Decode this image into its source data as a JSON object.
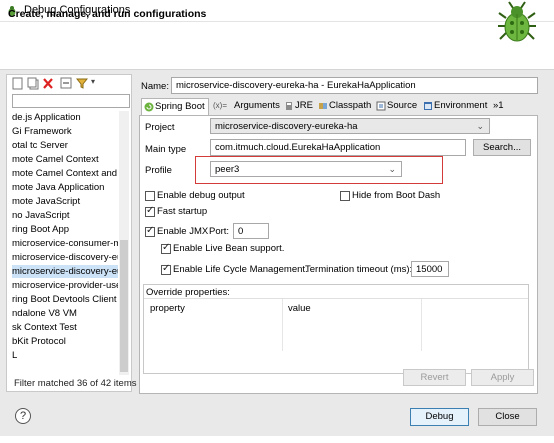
{
  "window": {
    "title": "Debug Configurations",
    "header_title": "Create, manage, and run configurations"
  },
  "left": {
    "filter_placeholder": "",
    "tree": [
      "de.js Application",
      "Gi Framework",
      "otal tc Server",
      "mote Camel Context",
      "mote Camel Context and J",
      "mote Java Application",
      "mote JavaScript",
      "no JavaScript",
      "ring Boot App",
      "microservice-consumer-m",
      "microservice-discovery-eu",
      "microservice-discovery-eu",
      "microservice-provider-use",
      "ring Boot Devtools Client",
      "ndalone V8 VM",
      "sk Context Test",
      "bKit Protocol",
      "L"
    ],
    "selected_index": 11,
    "status": "Filter matched 36 of 42 items"
  },
  "config": {
    "name_label": "Name:",
    "name_value": "microservice-discovery-eureka-ha - EurekaHaApplication",
    "tabs": [
      "Spring Boot",
      "Arguments",
      "JRE",
      "Classpath",
      "Source",
      "Environment",
      "»1"
    ],
    "project_label": "Project",
    "project_value": "microservice-discovery-eureka-ha",
    "main_type_label": "Main type",
    "main_type_value": "com.itmuch.cloud.EurekaHaApplication",
    "search_label": "Search...",
    "profile_label": "Profile",
    "profile_value": "peer3",
    "enable_debug_output": "Enable debug output",
    "hide_boot_dash": "Hide from Boot Dash",
    "fast_startup": "Fast startup",
    "enable_jmx": "Enable JMX",
    "port_label": "Port:",
    "port_value": "0",
    "live_bean": "Enable Live Bean support.",
    "lifecycle": "Enable Life Cycle Management.",
    "termination_label": "Termination timeout (ms):",
    "termination_value": "15000",
    "override_title": "Override properties:",
    "col_property": "property",
    "col_value": "value"
  },
  "buttons": {
    "revert": "Revert",
    "apply": "Apply",
    "debug": "Debug",
    "close": "Close"
  },
  "help": "?",
  "colors": {
    "highlight": "#d33a3a",
    "selection": "#cce2f6",
    "accent": "#3c7fb1"
  }
}
